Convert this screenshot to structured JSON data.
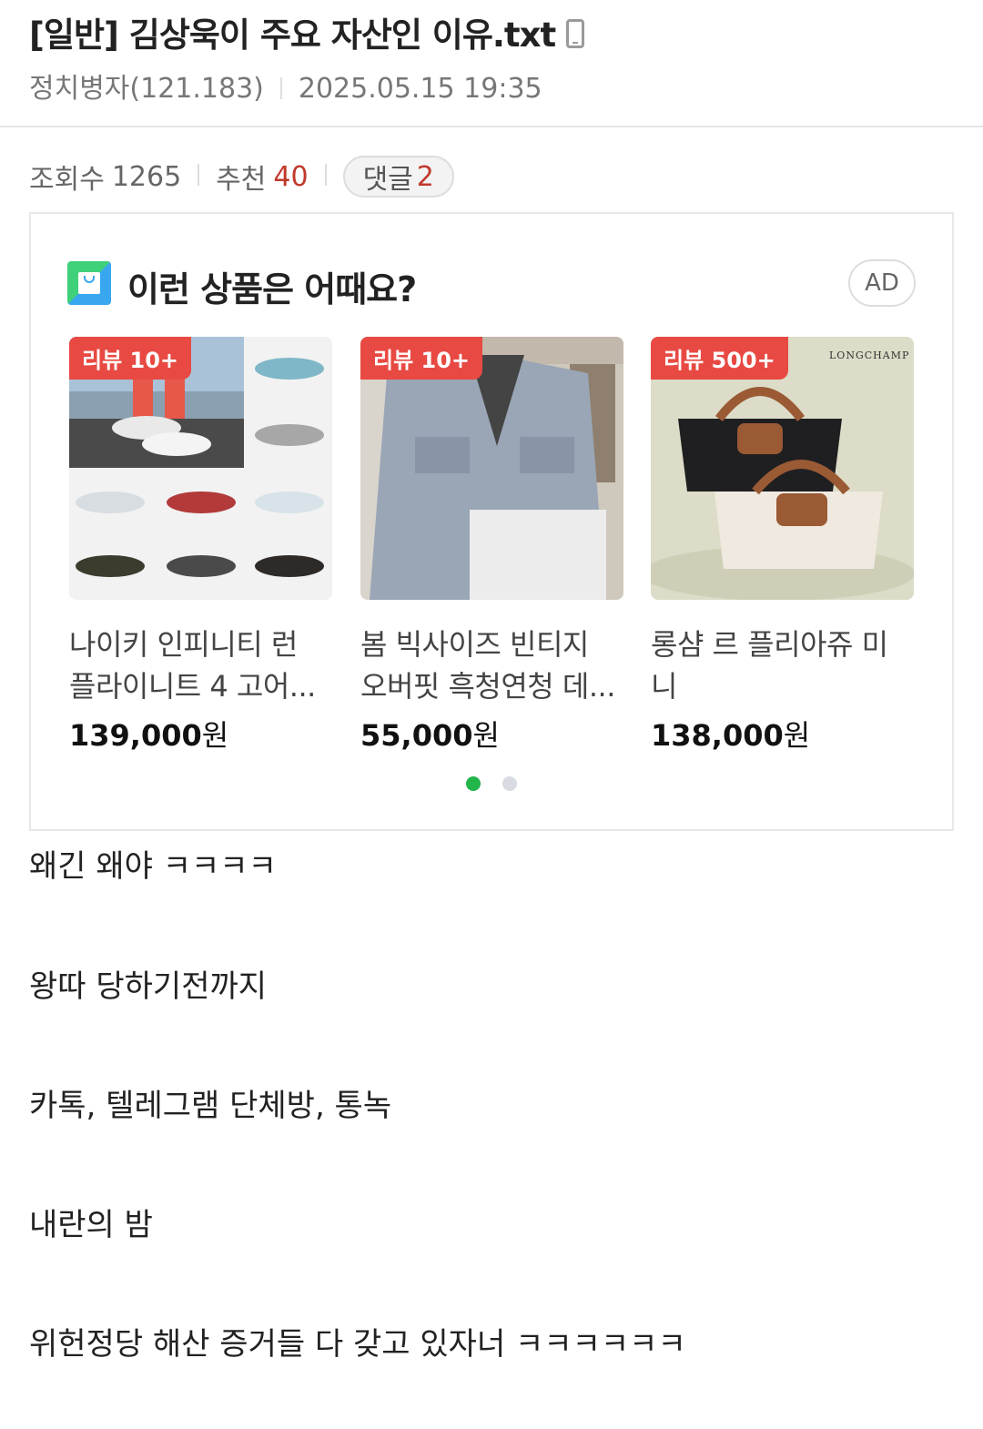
{
  "post": {
    "title": "[일반] 김상욱이 주요 자산인 이유.txt",
    "author": "정치병자(121.183)",
    "datetime": "2025.05.15 19:35"
  },
  "stats": {
    "views_label": "조회수",
    "views": "1265",
    "recommend_label": "추천",
    "recommend": "40",
    "comments_label": "댓글",
    "comments": "2"
  },
  "ad": {
    "title": "이런 상품은 어때요?",
    "badge": "AD",
    "products": [
      {
        "review": "리뷰 10+",
        "name": "나이키 인피니티 런 플라이니트 4 고어...",
        "price": "139,000",
        "currency": "원"
      },
      {
        "review": "리뷰 10+",
        "name": "봄 빅사이즈 빈티지 오버핏 흑청연청 데...",
        "price": "55,000",
        "currency": "원"
      },
      {
        "review": "리뷰 500+",
        "name": "롱샴 르 플리아쥬 미니",
        "price": "138,000",
        "currency": "원"
      }
    ],
    "brand_text": "LONGCHAMP",
    "active_page": 1,
    "page_count": 2
  },
  "content": {
    "lines": [
      "왜긴 왜야 ㅋㅋㅋㅋ",
      "왕따 당하기전까지",
      "카톡, 텔레그램 단체방, 통녹",
      "내란의 밤",
      "위헌정당 해산 증거들 다 갖고 있자너 ㅋㅋㅋㅋㅋㅋ"
    ]
  },
  "colors": {
    "accent_red": "#c0392b",
    "review_tag": "#e84a43",
    "active_dot": "#21b54a"
  }
}
